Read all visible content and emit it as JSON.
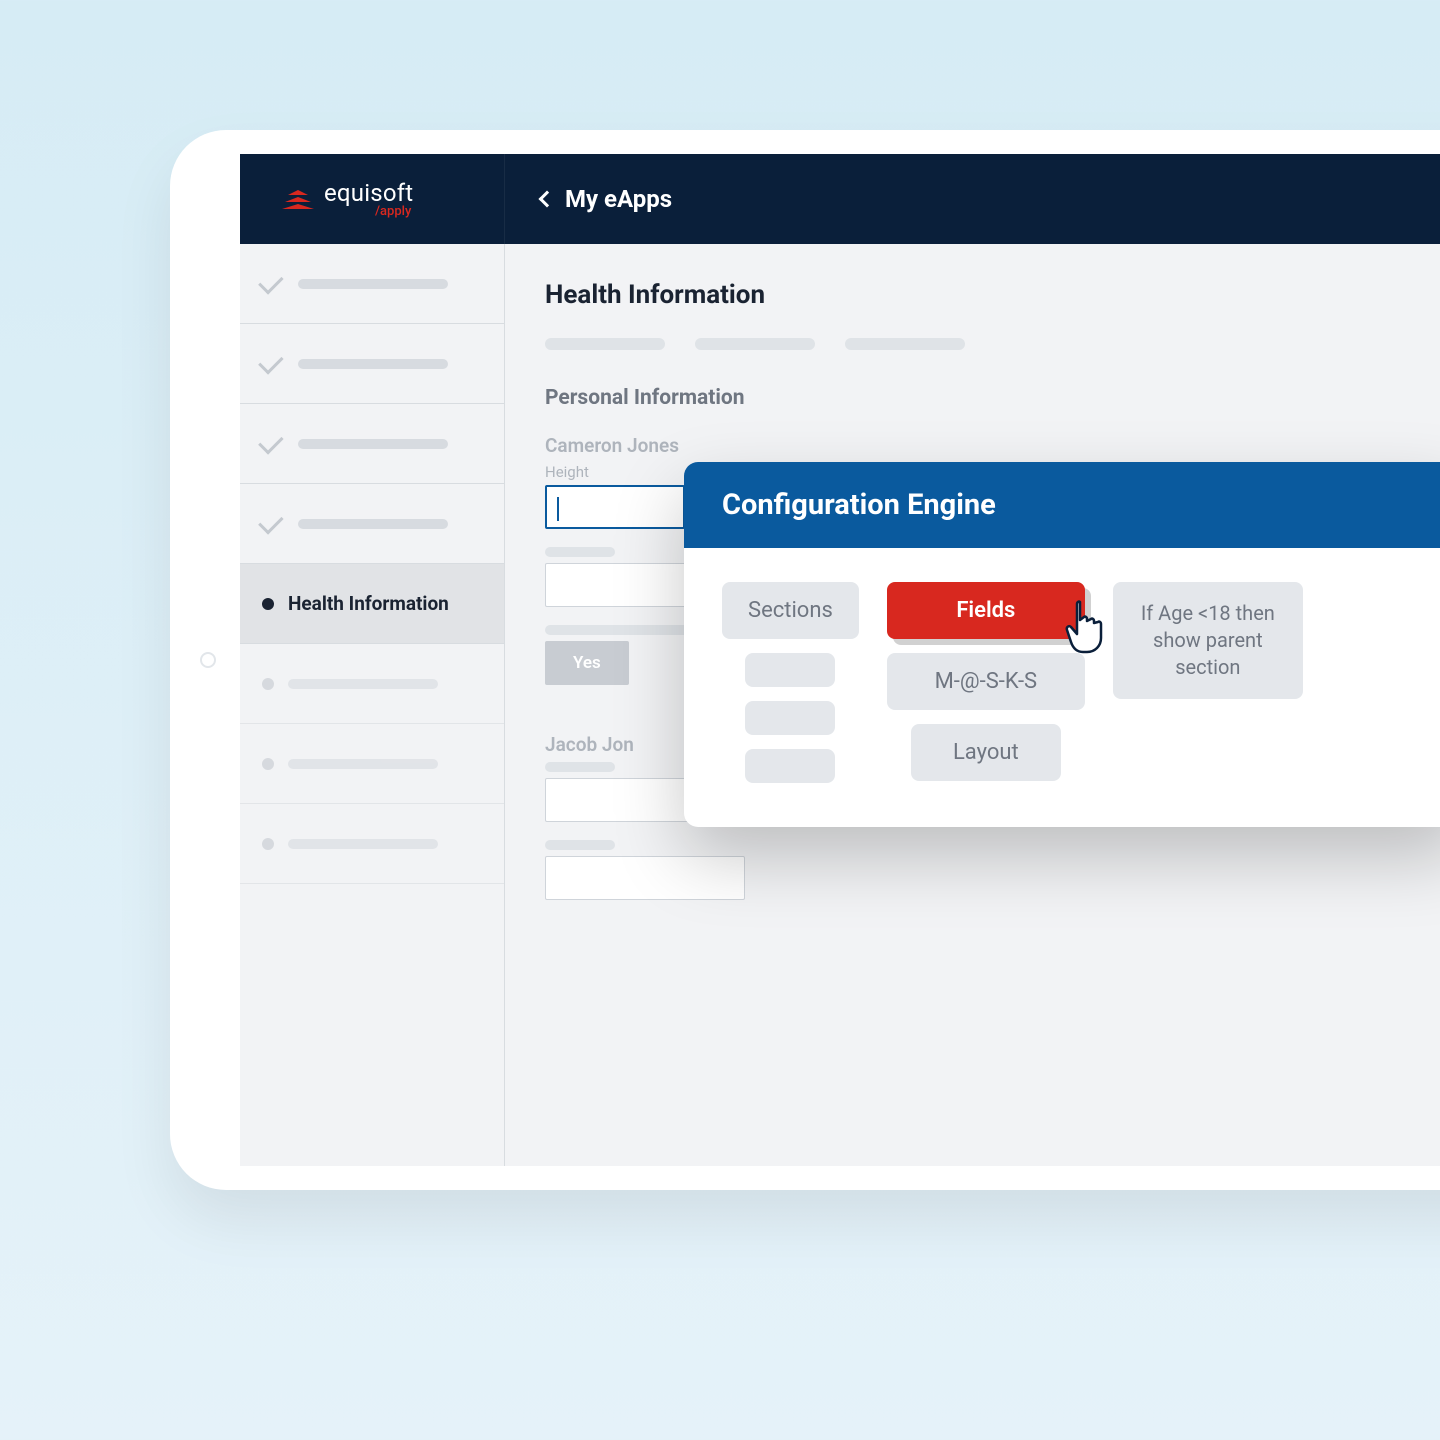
{
  "brand": {
    "name": "equisoft",
    "sub": "/apply"
  },
  "header": {
    "back_label": "My eApps"
  },
  "sidebar": {
    "active_label": "Health Information"
  },
  "main": {
    "title": "Health Information",
    "subhead": "Personal Information",
    "person1": "Cameron Jones",
    "height_label": "Height",
    "yes_label": "Yes",
    "person2": "Jacob Jon"
  },
  "config": {
    "title": "Configuration Engine",
    "sections_label": "Sections",
    "fields_label": "Fields",
    "masks_label": "M-@-S-K-S",
    "layout_label": "Layout",
    "rule_text": "If Age <18 then show parent section"
  }
}
